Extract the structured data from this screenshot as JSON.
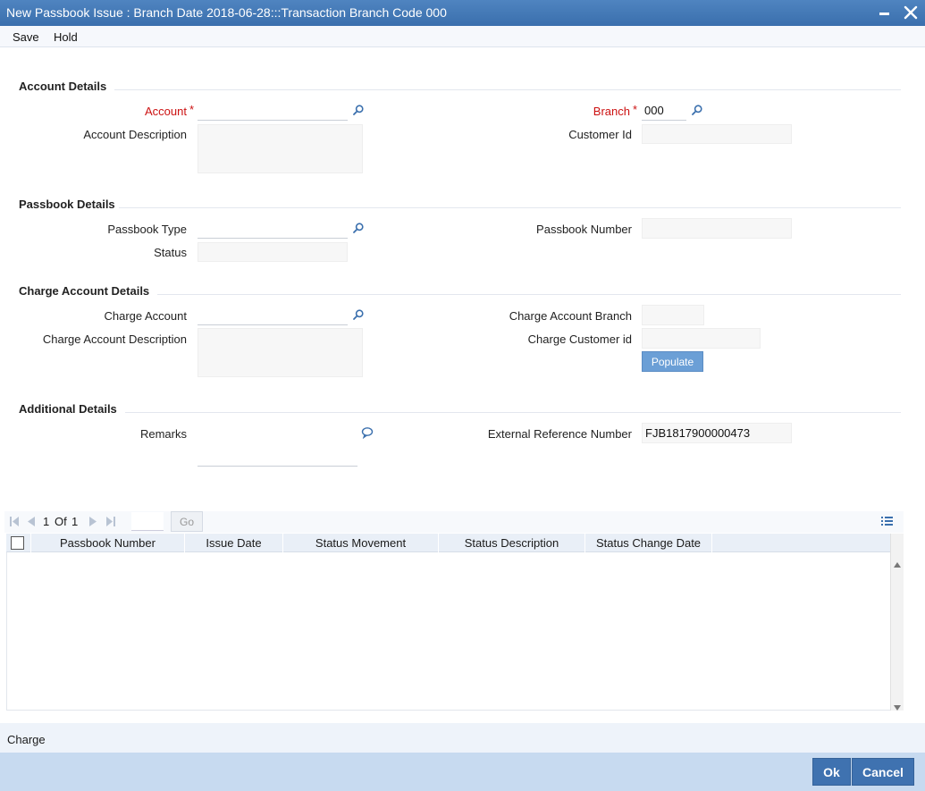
{
  "window": {
    "title": "New Passbook Issue : Branch Date 2018-06-28:::Transaction Branch Code 000"
  },
  "menu": {
    "save": "Save",
    "hold": "Hold"
  },
  "account_details": {
    "heading": "Account Details",
    "account_label": "Account",
    "account_value": "",
    "account_description_label": "Account Description",
    "account_description_value": "",
    "branch_label": "Branch",
    "branch_value": "000",
    "customer_id_label": "Customer Id",
    "customer_id_value": ""
  },
  "passbook_details": {
    "heading": "Passbook Details",
    "passbook_type_label": "Passbook Type",
    "passbook_type_value": "",
    "status_label": "Status",
    "status_value": "",
    "passbook_number_label": "Passbook Number",
    "passbook_number_value": ""
  },
  "charge_account_details": {
    "heading": "Charge Account Details",
    "charge_account_label": "Charge Account",
    "charge_account_value": "",
    "charge_account_description_label": "Charge Account Description",
    "charge_account_description_value": "",
    "charge_account_branch_label": "Charge Account Branch",
    "charge_account_branch_value": "",
    "charge_customer_id_label": "Charge Customer id",
    "charge_customer_id_value": "",
    "populate_button": "Populate"
  },
  "additional_details": {
    "heading": "Additional Details",
    "remarks_label": "Remarks",
    "remarks_value": "",
    "external_reference_label": "External Reference Number",
    "external_reference_value": "FJB1817900000473"
  },
  "grid": {
    "page_current": "1",
    "page_of": "Of",
    "page_total": "1",
    "go_label": "Go",
    "columns": [
      "Passbook Number",
      "Issue Date",
      "Status Movement",
      "Status Description",
      "Status Change Date"
    ],
    "rows": []
  },
  "footer": {
    "charge_tab": "Charge",
    "ok": "Ok",
    "cancel": "Cancel"
  },
  "colors": {
    "title_bar": "#3f74b3",
    "required_label": "#cc1111",
    "action_button": "#3f72b0",
    "populate_button": "#6b9fd6"
  }
}
